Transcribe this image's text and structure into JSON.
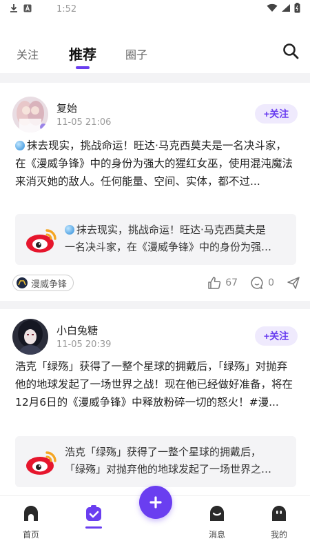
{
  "status_bar": {
    "time": "1:52"
  },
  "tabs": [
    {
      "label": "关注"
    },
    {
      "label": "推荐"
    },
    {
      "label": "圈子"
    }
  ],
  "posts": [
    {
      "username": "复始",
      "time": "11-05 21:06",
      "follow_label": "+关注",
      "content": "抹去现实，挑战命运！旺达·马克西莫夫是一名决斗家，在《漫威争锋》中的身份为强大的猩红女巫，使用混沌魔法来消灭她的敌人。任何能量、空间、实体，都不过...",
      "share_line1": "抹去现实，挑战命运！旺达·马克西莫夫是",
      "share_line2": "一名决斗家，在《漫威争锋》中的身份为强…",
      "topic": "漫威争锋",
      "likes": "67",
      "comments": "0"
    },
    {
      "username": "小白兔糖",
      "time": "11-05 20:39",
      "follow_label": "+关注",
      "content": "浩克「绿殇」获得了一整个星球的拥戴后，「绿殇」对抛弃他的地球发起了一场世界之战！现在他已经做好准备，将在12月6日的《漫威争锋》中释放粉碎一切的怒火！#漫...",
      "share_line1": "浩克「绿殇」获得了一整个星球的拥戴后，",
      "share_line2": "「绿殇」对抛弃他的地球发起了一场世界之…"
    }
  ],
  "bottom_nav": [
    {
      "label": "首页"
    },
    {
      "label": ""
    },
    {
      "label": "消息"
    },
    {
      "label": "我的"
    }
  ],
  "colors": {
    "accent": "#6a3ef0",
    "follow_bg": "#efeafd"
  }
}
